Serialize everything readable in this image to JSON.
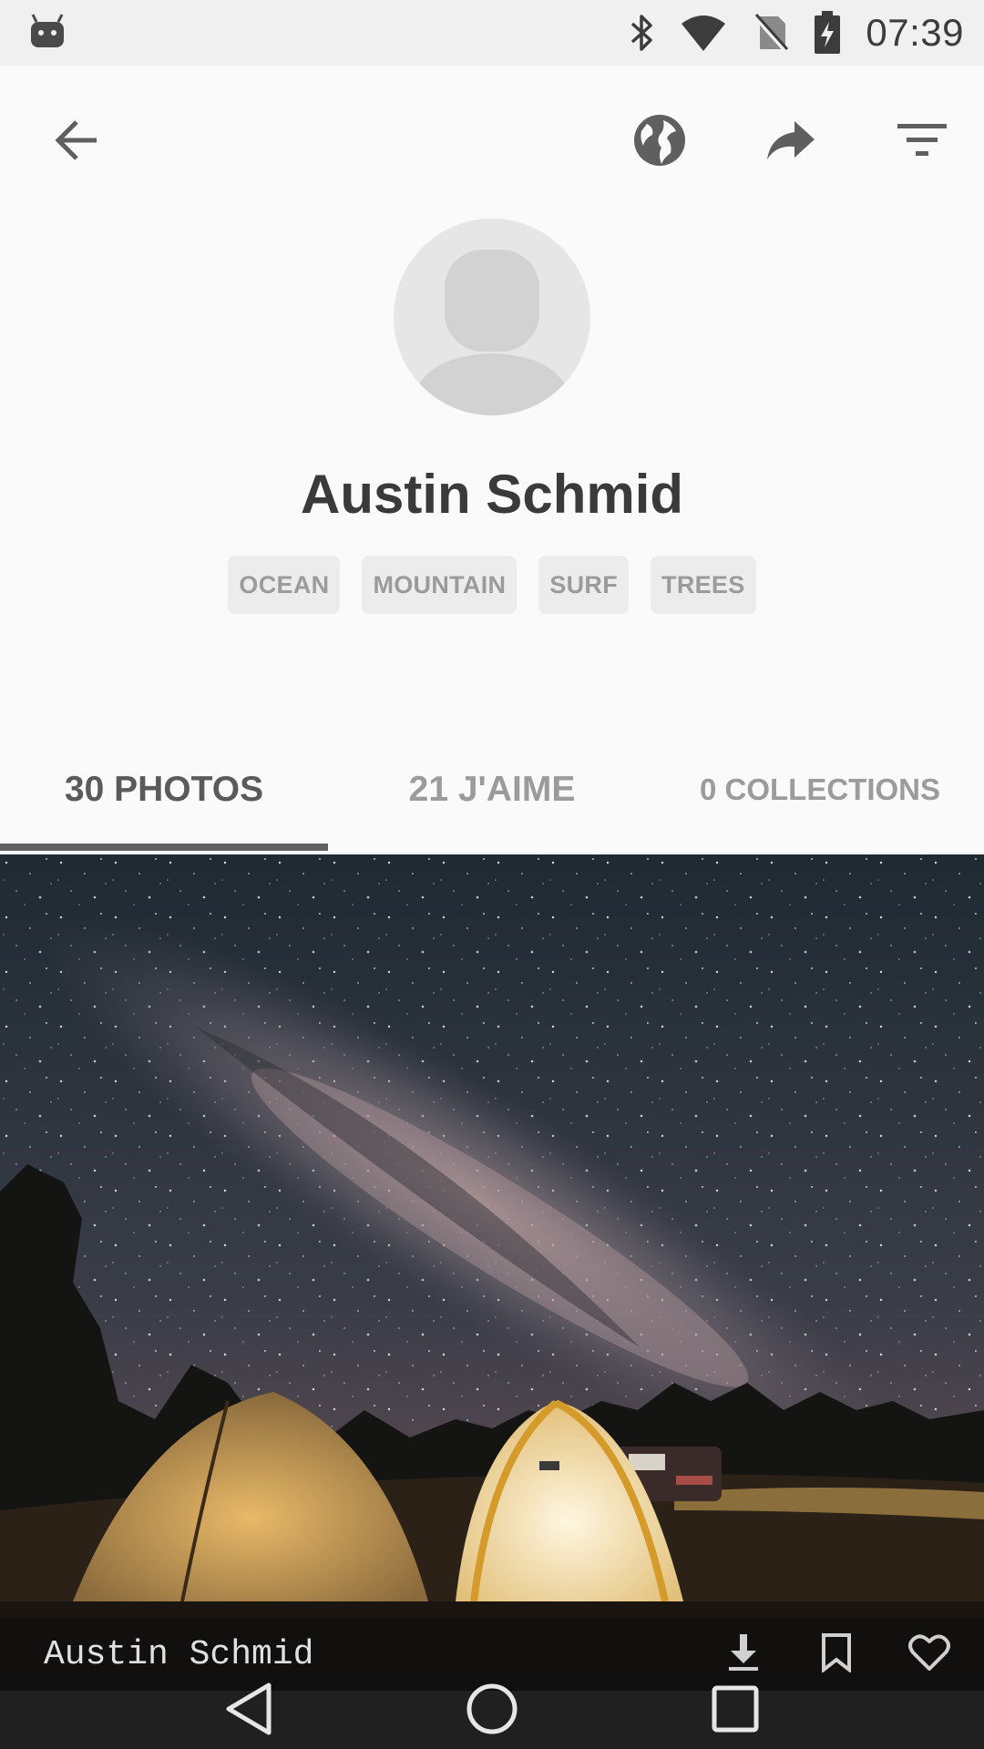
{
  "status_bar": {
    "time": "07:39",
    "icons": [
      "android-icon",
      "bluetooth-icon",
      "wifi-icon",
      "no-sim-icon",
      "battery-charging-icon"
    ]
  },
  "toolbar": {
    "icons": [
      "back-arrow-icon",
      "globe-icon",
      "share-icon",
      "filter-icon"
    ]
  },
  "profile": {
    "name": "Austin Schmid",
    "tags": [
      "OCEAN",
      "MOUNTAIN",
      "SURF",
      "TREES"
    ]
  },
  "tabs": [
    {
      "label": "30 PHOTOS",
      "active": true
    },
    {
      "label": "21 J'AIME",
      "active": false
    },
    {
      "label": "0 COLLECTIONS",
      "active": false
    }
  ],
  "photo": {
    "author": "Austin Schmid",
    "actions": [
      "download-icon",
      "bookmark-icon",
      "heart-icon"
    ]
  },
  "nav_bar": {
    "buttons": [
      "back-triangle-icon",
      "home-circle-icon",
      "recents-square-icon"
    ]
  },
  "colors": {
    "background": "#fafafa",
    "status_bar": "#f0f0f0",
    "text_dark": "#3a3a3a",
    "text_muted": "#9b9b9b",
    "tag_bg": "#ececec",
    "indicator": "#616161"
  }
}
